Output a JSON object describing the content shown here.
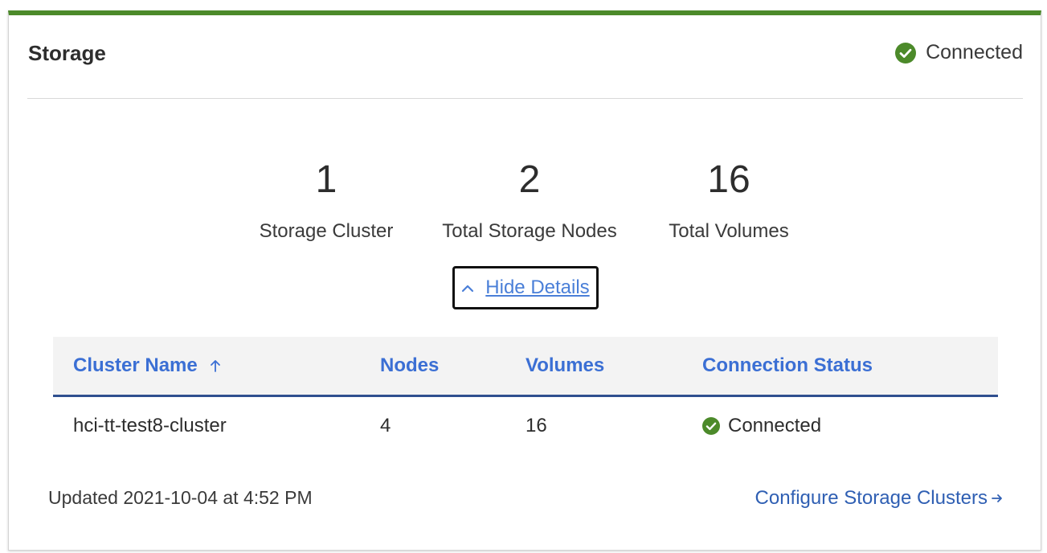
{
  "card": {
    "title": "Storage",
    "status": "Connected",
    "accent_color": "#4c8a2a",
    "status_icon": "check-circle-icon"
  },
  "stats": [
    {
      "value": "1",
      "label": "Storage Cluster"
    },
    {
      "value": "2",
      "label": "Total Storage Nodes"
    },
    {
      "value": "16",
      "label": "Total Volumes"
    }
  ],
  "details_toggle": {
    "label": "Hide Details",
    "icon": "chevron-up-icon"
  },
  "table": {
    "columns": [
      "Cluster Name",
      "Nodes",
      "Volumes",
      "Connection Status"
    ],
    "sort_icon": "arrow-up-icon",
    "rows": [
      {
        "cluster_name": "hci-tt-test8-cluster",
        "nodes": "4",
        "volumes": "16",
        "status": "Connected"
      }
    ]
  },
  "footer": {
    "updated": "Updated 2021-10-04 at 4:52 PM",
    "configure_label": "Configure Storage Clusters",
    "configure_icon": "arrow-right-icon"
  }
}
